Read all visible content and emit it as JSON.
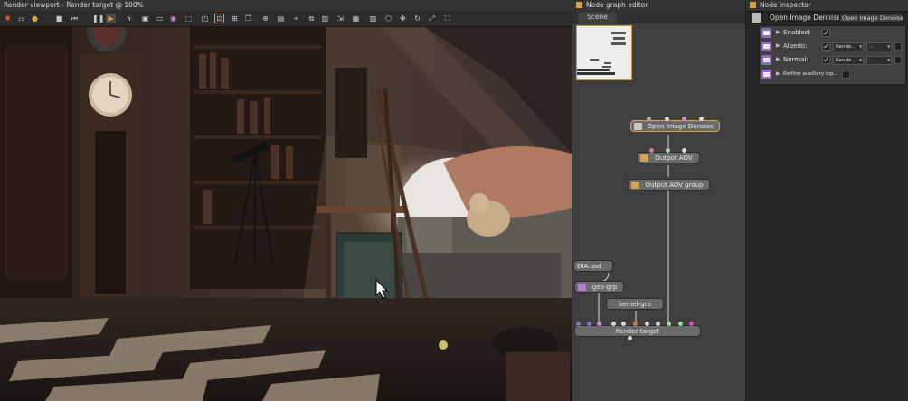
{
  "viewport": {
    "title": "Render viewport - Render target @ 100%",
    "toolbar_icons": [
      "render-icon",
      "film-icon",
      "sphere-icon",
      "stop-icon",
      "rewind-icon",
      "pause-icon",
      "play-icon",
      "lightning-icon",
      "camera-icon",
      "display-icon",
      "color-wheel-icon",
      "materials-icon",
      "region-icon",
      "region-select-icon",
      "picker-icon",
      "copy-icon",
      "zoom-icon",
      "brush-icon",
      "pick-object-icon",
      "duplicate-icon",
      "save-icon",
      "export-icon",
      "lock-icon",
      "cube-icon",
      "move-icon",
      "rotate-icon",
      "fit-icon",
      "zoom-fit-icon"
    ]
  },
  "node_graph": {
    "title": "Node graph editor",
    "tab": "Scene",
    "nodes": {
      "denoise": "Open Image Denoise",
      "output_aov": "Output AOV",
      "output_aov_group": "Output AOV group",
      "usd": "DIA.usd",
      "geo": "geo-grp",
      "kernel": "kernel-grp",
      "render_target": "Render target"
    }
  },
  "inspector": {
    "title": "Node inspector",
    "node_name": "Open Image Denoise",
    "node_type": "Open Image Denoise",
    "params": {
      "enabled_label": "Enabled:",
      "albedo_label": "Albedo:",
      "albedo_source": "Rende..",
      "albedo_layer": "...",
      "normal_label": "Normal:",
      "normal_source": "Rende..",
      "normal_layer": "...",
      "aux_label": "Refilter auxiliary inp..."
    }
  },
  "colors": {
    "accent": "#d6a53a",
    "inspector_icon": "#8c6cb2",
    "node": "#6a6a6a"
  }
}
